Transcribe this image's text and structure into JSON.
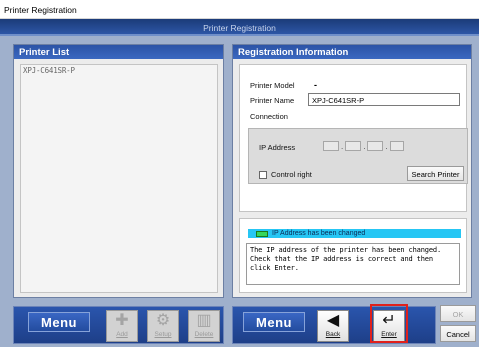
{
  "window": {
    "title": "Printer Registration"
  },
  "header": {
    "title": "Printer Registration"
  },
  "printer_list": {
    "heading": "Printer List",
    "items": [
      "XPJ-C641SR-P"
    ]
  },
  "registration": {
    "heading": "Registration Information",
    "model_label": "Printer Model",
    "model_value": "-",
    "name_label": "Printer Name",
    "name_value": "XPJ-C641SR-P",
    "connection_label": "Connection",
    "ip_label": "IP Address",
    "ip_separator": ".",
    "control_right_label": "Control right",
    "search_button": "Search Printer"
  },
  "status": {
    "indicator_text": "IP Address has been changed",
    "led_color": "#34d65c",
    "bar_color": "#26c6f4",
    "message_lines": [
      "The IP address of the printer has been changed.",
      "Check that the IP address is correct and then",
      "click Enter."
    ]
  },
  "toolbar_left": {
    "menu_label": "Menu",
    "add_label": "Add",
    "setup_label": "Setup",
    "delete_label": "Delete"
  },
  "toolbar_right": {
    "menu_label": "Menu",
    "back_label": "Back",
    "enter_label": "Enter",
    "ok_label": "OK",
    "cancel_label": "Cancel"
  },
  "icons": {
    "add": "plus-icon",
    "setup": "gear-icon",
    "delete": "trash-icon",
    "back": "arrow-left-icon",
    "enter": "enter-icon"
  }
}
